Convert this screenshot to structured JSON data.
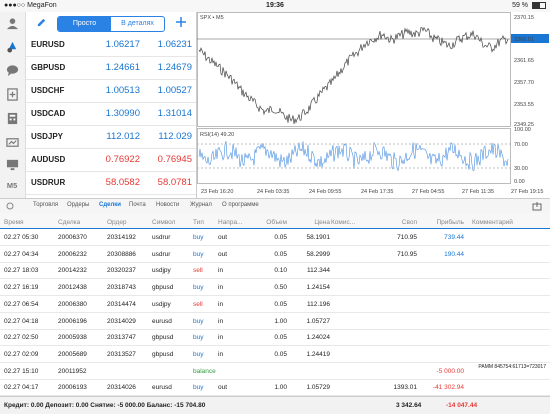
{
  "status_bar": {
    "carrier": "●●●○○ MegaFon",
    "time": "19:36",
    "battery": "59 %"
  },
  "quotes": {
    "mode_simple": "Просто",
    "mode_detailed": "В деталях",
    "rows": [
      {
        "symbol": "EURUSD",
        "bid": "1.06217",
        "ask": "1.06231",
        "color": "blue"
      },
      {
        "symbol": "GBPUSD",
        "bid": "1.24661",
        "ask": "1.24679",
        "color": "blue"
      },
      {
        "symbol": "USDCHF",
        "bid": "1.00513",
        "ask": "1.00527",
        "color": "blue"
      },
      {
        "symbol": "USDCAD",
        "bid": "1.30990",
        "ask": "1.31014",
        "color": "blue"
      },
      {
        "symbol": "USDJPY",
        "bid": "112.012",
        "ask": "112.029",
        "color": "blue"
      },
      {
        "symbol": "AUDUSD",
        "bid": "0.76922",
        "ask": "0.76945",
        "color": "red"
      },
      {
        "symbol": "USDRUR",
        "bid": "58.0582",
        "ask": "58.0781",
        "color": "red"
      }
    ]
  },
  "chart": {
    "title": "SPX • M5",
    "price_labels": [
      "2370.15",
      "2366.01",
      "2361.65",
      "2357.70",
      "2353.55",
      "2349.25"
    ],
    "current_price": "2366.01",
    "rsi_label": "RSI(14) 49.20",
    "rsi_levels": [
      "100.00",
      "70.00",
      "30.00",
      "0.00"
    ],
    "time_labels": [
      "23 Feb 16:20",
      "24 Feb 03:35",
      "24 Feb 09:55",
      "24 Feb 17:35",
      "27 Feb 04:55",
      "27 Feb 11:35",
      "27 Feb 19:15"
    ]
  },
  "tabs": [
    "Торговля",
    "Ордеры",
    "Сделки",
    "Почта",
    "Новости",
    "Журнал",
    "О программе"
  ],
  "active_tab": "Сделки",
  "columns": [
    "Время",
    "Сделка",
    "Ордер",
    "Символ",
    "Тип",
    "Напра...",
    "Объем",
    "Цена",
    "Комис...",
    "Своп",
    "Прибыль",
    "Комментарий"
  ],
  "deals": [
    {
      "time": "02.27 05:30",
      "deal": "20006370",
      "order": "20314192",
      "symbol": "usdrur",
      "type": "buy",
      "dir": "out",
      "volume": "0.05",
      "price": "58.1901",
      "commission": "",
      "swap": "710.95",
      "profit": "739.44",
      "comment": "",
      "type_cls": "buy",
      "profit_cls": "pos"
    },
    {
      "time": "02.27 04:34",
      "deal": "20006232",
      "order": "20308886",
      "symbol": "usdrur",
      "type": "buy",
      "dir": "out",
      "volume": "0.05",
      "price": "58.2999",
      "commission": "",
      "swap": "710.95",
      "profit": "190.44",
      "comment": "",
      "type_cls": "buy",
      "profit_cls": "pos"
    },
    {
      "time": "02.27 18:03",
      "deal": "20014232",
      "order": "20320237",
      "symbol": "usdjpy",
      "type": "sell",
      "dir": "in",
      "volume": "0.10",
      "price": "112.344",
      "commission": "",
      "swap": "",
      "profit": "",
      "comment": "",
      "type_cls": "sell",
      "profit_cls": ""
    },
    {
      "time": "02.27 16:19",
      "deal": "20012438",
      "order": "20318743",
      "symbol": "gbpusd",
      "type": "buy",
      "dir": "in",
      "volume": "0.50",
      "price": "1.24154",
      "commission": "",
      "swap": "",
      "profit": "",
      "comment": "",
      "type_cls": "buy",
      "profit_cls": ""
    },
    {
      "time": "02.27 06:54",
      "deal": "20006380",
      "order": "20314474",
      "symbol": "usdjpy",
      "type": "sell",
      "dir": "in",
      "volume": "0.05",
      "price": "112.196",
      "commission": "",
      "swap": "",
      "profit": "",
      "comment": "",
      "type_cls": "sell",
      "profit_cls": ""
    },
    {
      "time": "02.27 04:18",
      "deal": "20006196",
      "order": "20314029",
      "symbol": "eurusd",
      "type": "buy",
      "dir": "in",
      "volume": "1.00",
      "price": "1.05727",
      "commission": "",
      "swap": "",
      "profit": "",
      "comment": "",
      "type_cls": "buy",
      "profit_cls": ""
    },
    {
      "time": "02.27 02:50",
      "deal": "20005938",
      "order": "20313747",
      "symbol": "gbpusd",
      "type": "buy",
      "dir": "in",
      "volume": "0.05",
      "price": "1.24024",
      "commission": "",
      "swap": "",
      "profit": "",
      "comment": "",
      "type_cls": "buy",
      "profit_cls": ""
    },
    {
      "time": "02.27 02:09",
      "deal": "20005689",
      "order": "20313527",
      "symbol": "gbpusd",
      "type": "buy",
      "dir": "in",
      "volume": "0.05",
      "price": "1.24419",
      "commission": "",
      "swap": "",
      "profit": "",
      "comment": "",
      "type_cls": "buy",
      "profit_cls": ""
    },
    {
      "time": "02.27 15:10",
      "deal": "20011952",
      "order": "",
      "symbol": "",
      "type": "balance",
      "dir": "",
      "volume": "",
      "price": "",
      "commission": "",
      "swap": "",
      "profit": "-5 000.00",
      "comment": "PAMM 845754:61713=723017",
      "type_cls": "bal",
      "profit_cls": "neg"
    },
    {
      "time": "02.27 04:17",
      "deal": "20006193",
      "order": "20314026",
      "symbol": "eurusd",
      "type": "buy",
      "dir": "out",
      "volume": "1.00",
      "price": "1.05729",
      "commission": "",
      "swap": "1393.01",
      "profit": "-41 302.94",
      "comment": "",
      "type_cls": "buy",
      "profit_cls": "neg"
    }
  ],
  "footer": {
    "summary": "Кредит: 0.00 Депозит: 0.00 Снятие: -5 000.00 Баланс: -15 704.80",
    "swap_total": "3 342.64",
    "profit_total": "-14 047.44"
  }
}
